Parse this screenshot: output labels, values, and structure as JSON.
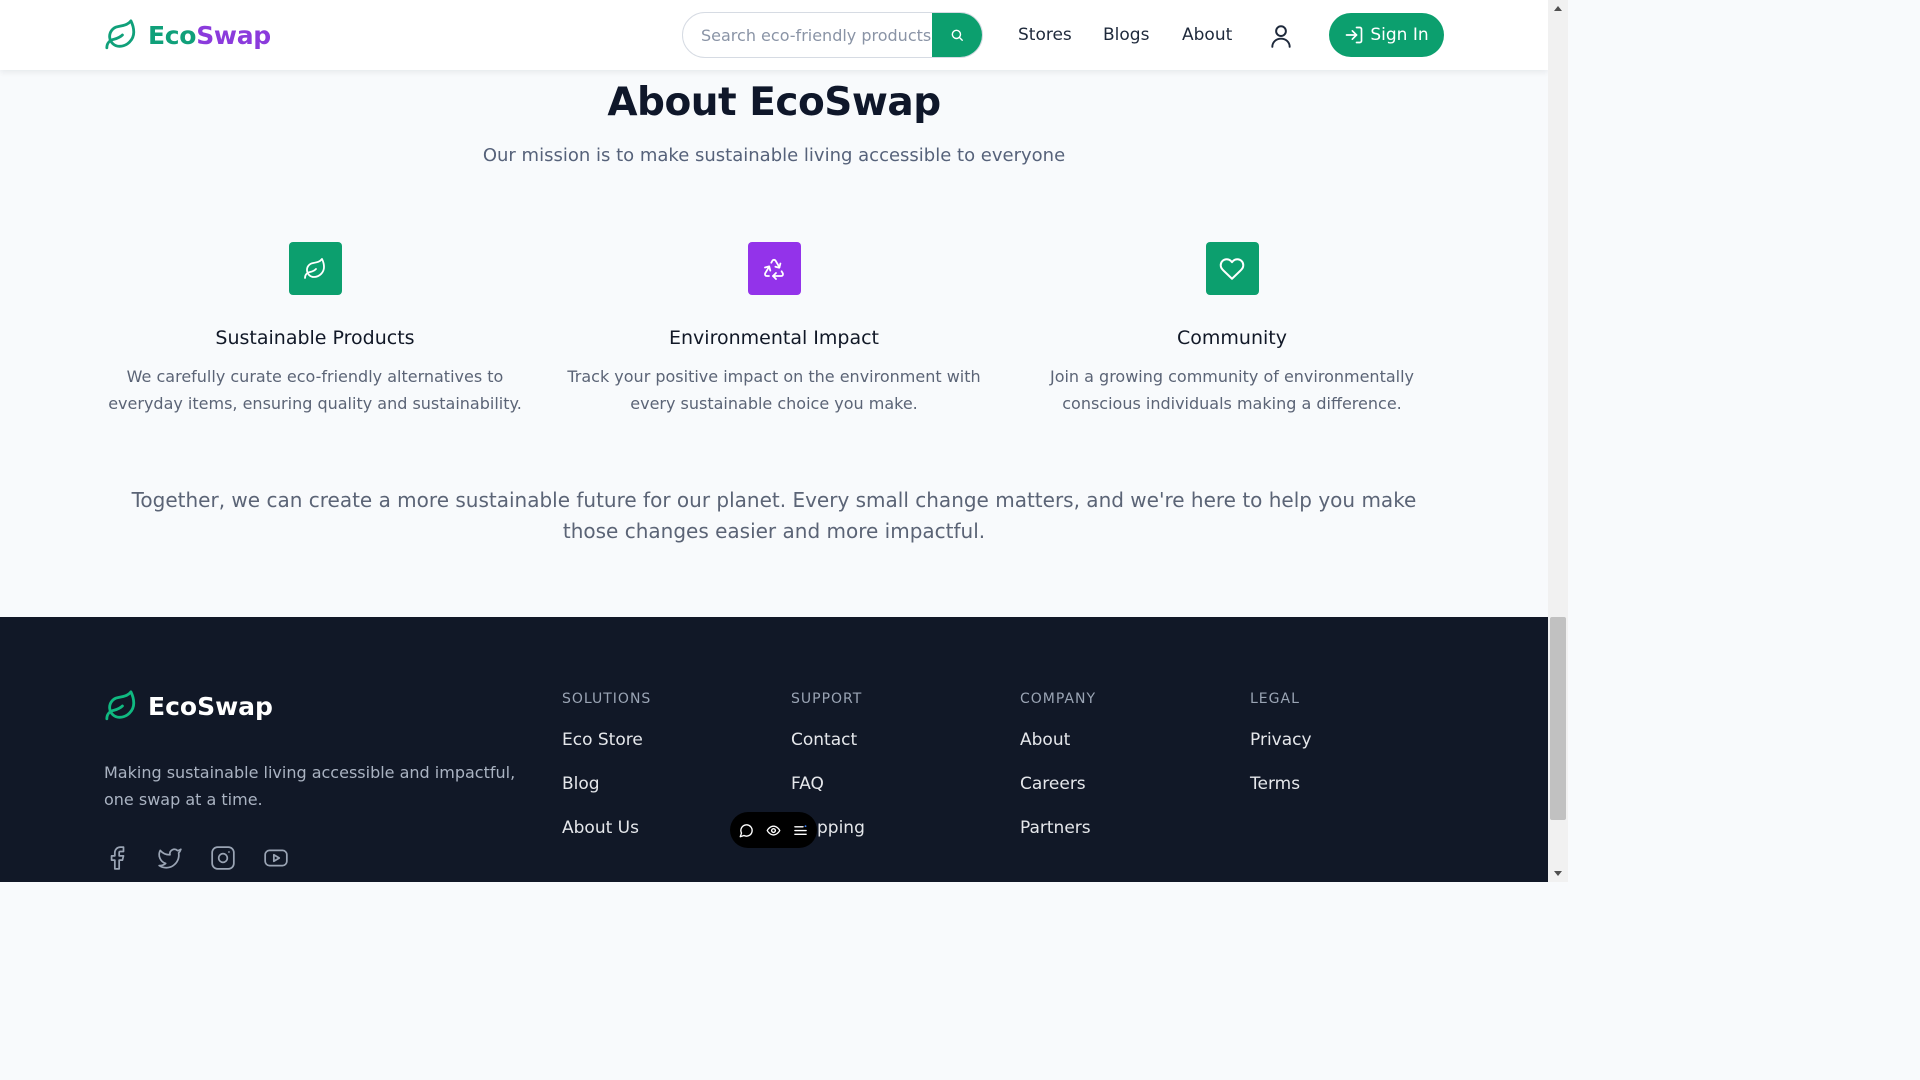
{
  "header": {
    "logo_part1": "Eco",
    "logo_part2": "Swap",
    "search_placeholder": "Search eco-friendly products",
    "nav": [
      "Stores",
      "Blogs",
      "About"
    ],
    "signin_label": "Sign In"
  },
  "about": {
    "title": "About EcoSwap",
    "subtitle": "Our mission is to make sustainable living accessible to everyone",
    "features": [
      {
        "title": "Sustainable Products",
        "desc": "We carefully curate eco-friendly alternatives to everyday items, ensuring quality and sustainability.",
        "icon": "leaf-icon",
        "color": "#0c9f6e"
      },
      {
        "title": "Environmental Impact",
        "desc": "Track your positive impact on the environment with every sustainable choice you make.",
        "icon": "recycle-icon",
        "color": "#9333ea"
      },
      {
        "title": "Community",
        "desc": "Join a growing community of environmentally conscious individuals making a difference.",
        "icon": "heart-icon",
        "color": "#0c9f6e"
      }
    ],
    "together": "Together, we can create a more sustainable future for our planet. Every small change matters, and we're here to help you make those changes easier and more impactful."
  },
  "footer": {
    "logo": "EcoSwap",
    "tagline": "Making sustainable living accessible and impactful, one swap at a time.",
    "socials": [
      "facebook-icon",
      "twitter-icon",
      "instagram-icon",
      "youtube-icon"
    ],
    "columns": [
      {
        "heading": "SOLUTIONS",
        "links": [
          "Eco Store",
          "Blog",
          "About Us"
        ]
      },
      {
        "heading": "SUPPORT",
        "links": [
          "Contact",
          "FAQ",
          "pping"
        ]
      },
      {
        "heading": "COMPANY",
        "links": [
          "About",
          "Careers",
          "Partners"
        ]
      },
      {
        "heading": "LEGAL",
        "links": [
          "Privacy",
          "Terms"
        ]
      }
    ]
  },
  "colors": {
    "brand_green": "#0c9f6e",
    "brand_purple": "#8b3bdc",
    "footer_bg": "#111827"
  }
}
